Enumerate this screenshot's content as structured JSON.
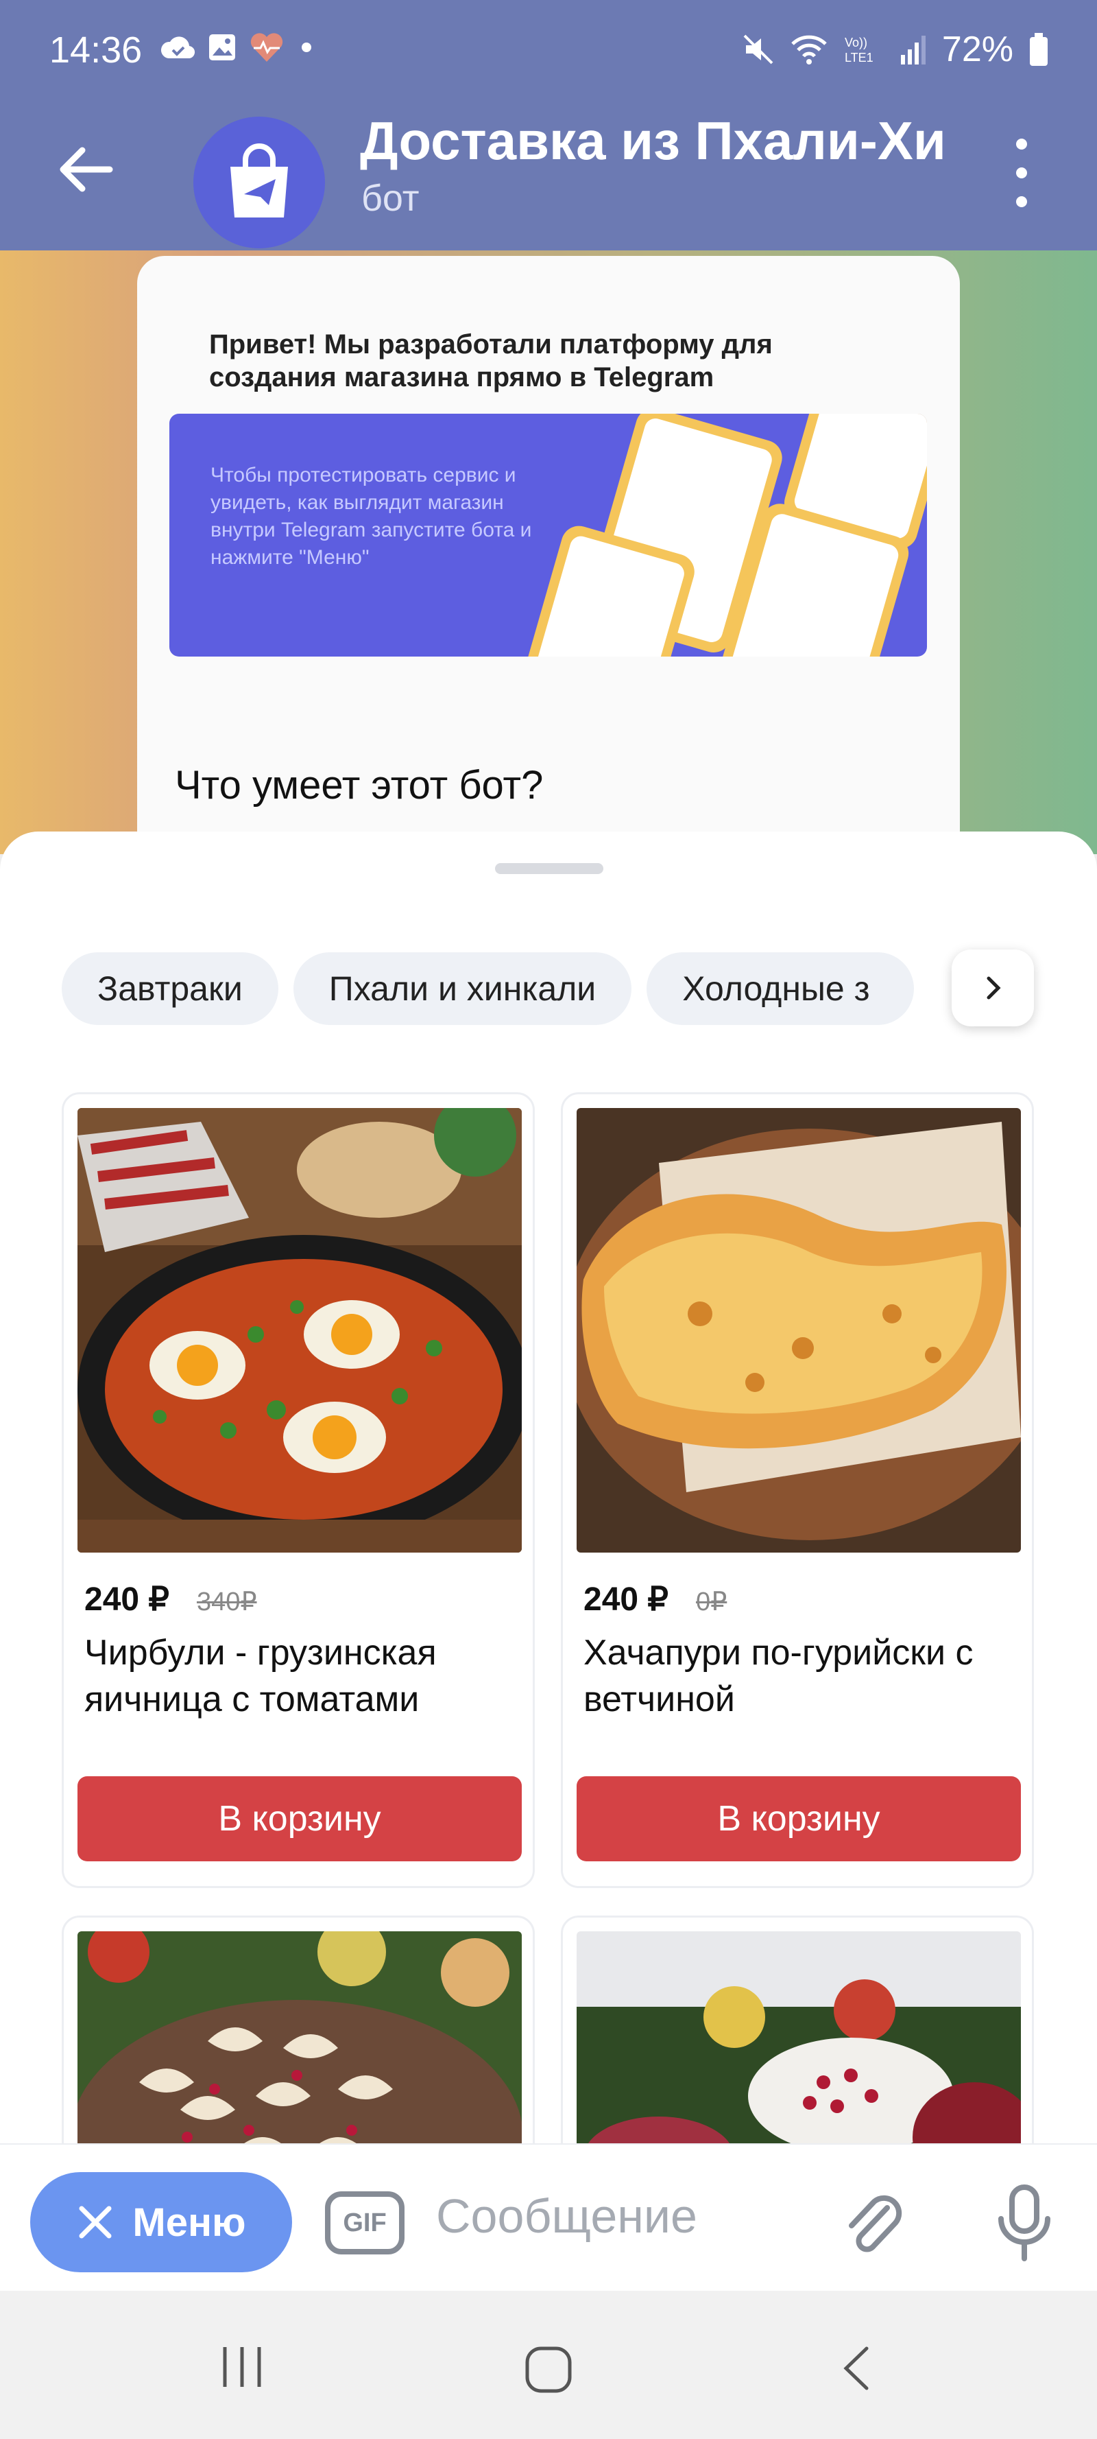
{
  "status_bar": {
    "time": "14:36",
    "battery": "72%",
    "icons": [
      "cloud-check-icon",
      "gallery-icon",
      "heart-pulse-icon",
      "dot-icon",
      "mute-icon",
      "wifi-icon",
      "volte-icon",
      "signal-icon",
      "battery-icon"
    ]
  },
  "header": {
    "title": "Доставка из Пхали-Хи",
    "subtitle": "бот"
  },
  "chat": {
    "intro_heading": "Привет! Мы разработали платформу для создания магазина прямо в Telegram",
    "promo_text": "Чтобы протестировать сервис и увидеть, как выглядит магазин внутри Telegram запустите бота и нажмите \"Меню\"",
    "question": "Что умеет этот бот?"
  },
  "categories": [
    "Завтраки",
    "Пхали и хинкали",
    "Холодные з"
  ],
  "products": [
    {
      "price": "240 ₽",
      "old_price": "340₽",
      "name": "Чирбули - грузинская яичница с томатами",
      "button": "В корзину"
    },
    {
      "price": "240 ₽",
      "old_price": "0₽",
      "name": "Хачапури по-гурийски с ветчиной",
      "button": "В корзину"
    }
  ],
  "input_bar": {
    "menu_label": "Меню",
    "gif_label": "GIF",
    "message_placeholder": "Сообщение"
  },
  "colors": {
    "header_bg": "#6c7ab3",
    "cart_button": "#d44245",
    "menu_button": "#6b95f0",
    "promo_bg": "#5d5ee0"
  }
}
